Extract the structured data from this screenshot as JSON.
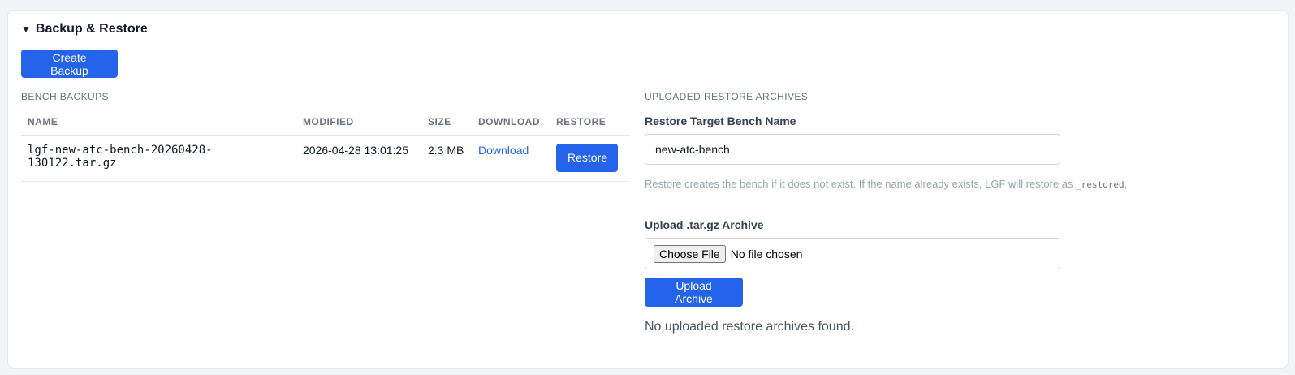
{
  "section": {
    "title": "Backup & Restore",
    "toggle_glyph": "▼"
  },
  "actions": {
    "create_backup_label": "Create Backup"
  },
  "bench_backups": {
    "heading": "BENCH BACKUPS",
    "columns": [
      "NAME",
      "MODIFIED",
      "SIZE",
      "DOWNLOAD",
      "RESTORE"
    ],
    "rows": [
      {
        "name": "lgf-new-atc-bench-20260428-130122.tar.gz",
        "modified": "2026-04-28 13:01:25",
        "size": "2.3 MB",
        "download_label": "Download",
        "restore_label": "Restore"
      }
    ]
  },
  "uploaded": {
    "heading": "UPLOADED RESTORE ARCHIVES",
    "target_label": "Restore Target Bench Name",
    "target_value": "new-atc-bench",
    "help_prefix": "Restore creates the bench if it does not exist. If the name already exists, LGF will restore as ",
    "help_code": "_restored",
    "help_suffix": ".",
    "upload_label": "Upload .tar.gz Archive",
    "choose_file_label": "Choose File",
    "file_status": "No file chosen",
    "upload_button_label": "Upload Archive",
    "empty_message": "No uploaded restore archives found."
  },
  "colors": {
    "primary": "#2563eb",
    "muted": "#6b7280",
    "border": "#e5e7eb"
  }
}
